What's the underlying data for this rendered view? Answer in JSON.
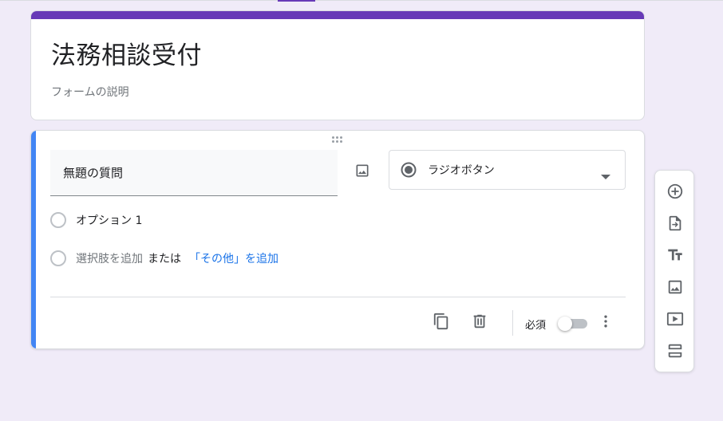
{
  "form": {
    "title": "法務相談受付",
    "description_placeholder": "フォームの説明"
  },
  "question": {
    "title": "無題の質問",
    "type_label": "ラジオボタン",
    "options": [
      {
        "label": "オプション 1"
      }
    ],
    "add_option": {
      "label": "選択肢を追加",
      "or": "または",
      "add_other": "「その他」を追加"
    },
    "required_label": "必須",
    "required": false
  },
  "icons": {
    "drag": "drag-handle-icon",
    "image": "image-icon",
    "radio": "radio-checked-icon",
    "dropdown": "arrow-drop-down-icon",
    "duplicate": "copy-icon",
    "delete": "trash-icon",
    "more": "more-vert-icon"
  },
  "side_toolbar": {
    "items": [
      {
        "icon": "add-circle-icon",
        "name": "add-question"
      },
      {
        "icon": "import-icon",
        "name": "import-questions"
      },
      {
        "icon": "title-icon",
        "name": "add-title"
      },
      {
        "icon": "image-icon",
        "name": "add-image"
      },
      {
        "icon": "video-icon",
        "name": "add-video"
      },
      {
        "icon": "section-icon",
        "name": "add-section"
      }
    ]
  },
  "colors": {
    "background": "#f0ebf8",
    "header_accent": "#673ab7",
    "active_accent": "#4285f4",
    "link": "#1a73e8",
    "icon": "#5f6368"
  }
}
